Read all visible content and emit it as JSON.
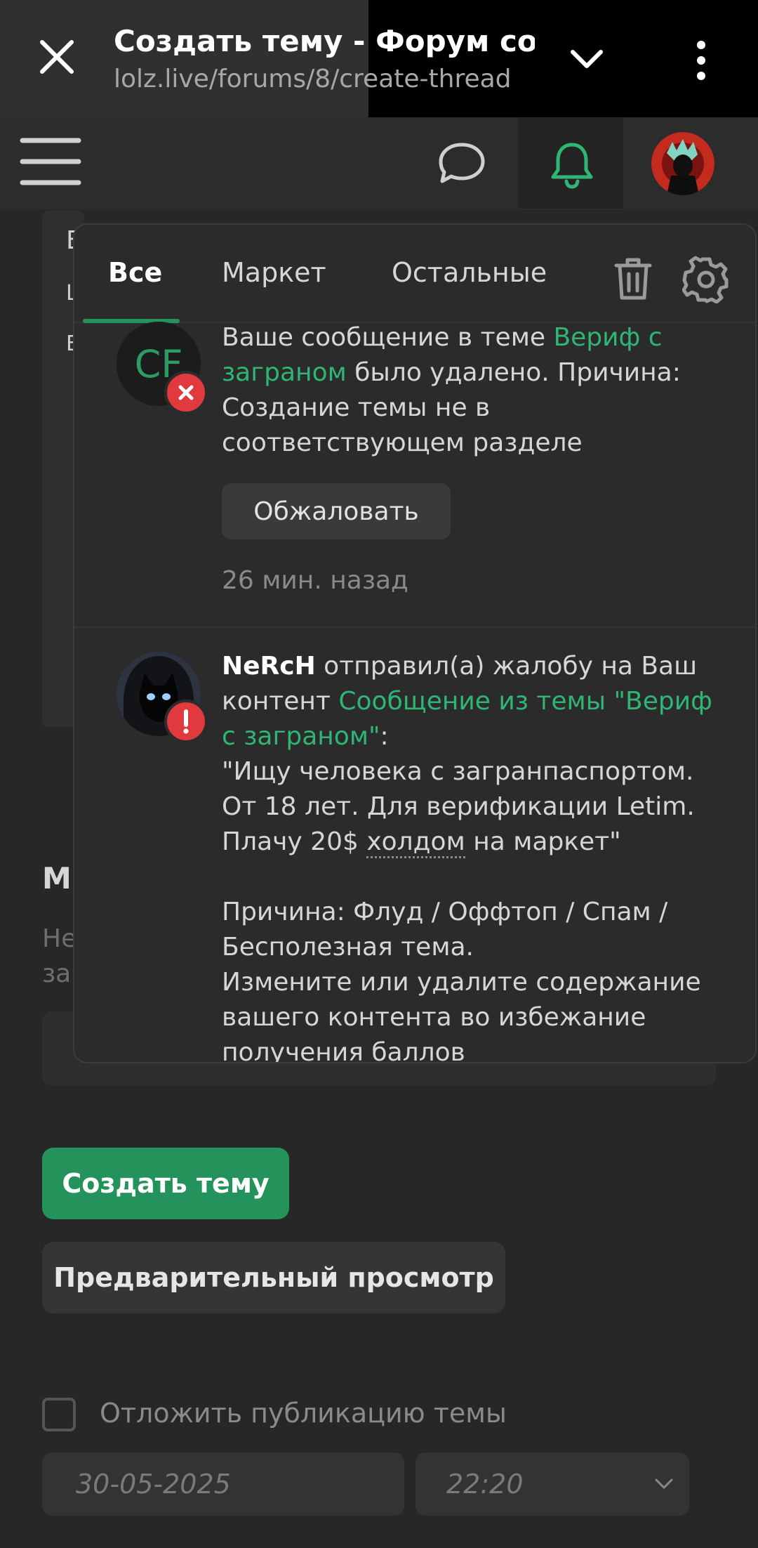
{
  "browser": {
    "title": "Создать тему - Форум соц",
    "url": "lolz.live/forums/8/create-thread"
  },
  "header": {
    "icons": [
      "menu-icon",
      "chat-icon",
      "bell-icon",
      "avatar"
    ]
  },
  "background_page": {
    "peek_letters": [
      "E",
      "L",
      "E"
    ],
    "section_heading": "М",
    "section_desc_line1": "Не",
    "section_desc_line2": "за",
    "create_button": "Создать тему",
    "preview_button": "Предварительный просмотр",
    "delay_label": "Отложить публикацию темы",
    "date_value": "30-05-2025",
    "time_value": "22:20"
  },
  "notifications": {
    "tabs": {
      "all": "Все",
      "market": "Маркет",
      "other": "Остальные"
    },
    "items": [
      {
        "avatar_initials": "CF",
        "text_before": "Ваше сообщение в теме ",
        "link": "Вериф с заграном",
        "text_after": " было удалено. Причина: Создание темы не в соответствующем разделе",
        "action_button": "Обжаловать",
        "time": "26 мин. назад"
      },
      {
        "user": "NeRcH",
        "text_before": " отправил(а) жалобу на Ваш контент ",
        "link": "Сообщение из темы \"Вериф с заграном\"",
        "colon": ":",
        "quote_part1": "\"Ищу человека с загранпаспортом. От 18 лет. Для верификации Letim. Плачу 20$ ",
        "quote_dotted": "холдом",
        "quote_part2": " на маркет\"",
        "reason": "Причина: Флуд / Оффтоп / Спам / Бесполезная тема.",
        "advice": "Измените или удалите содержание вашего контента во избежание получения баллов"
      }
    ]
  },
  "colors": {
    "accent_green": "#24935b",
    "link_green": "#2fb574",
    "badge_red": "#e0393e",
    "background": "#272727"
  }
}
